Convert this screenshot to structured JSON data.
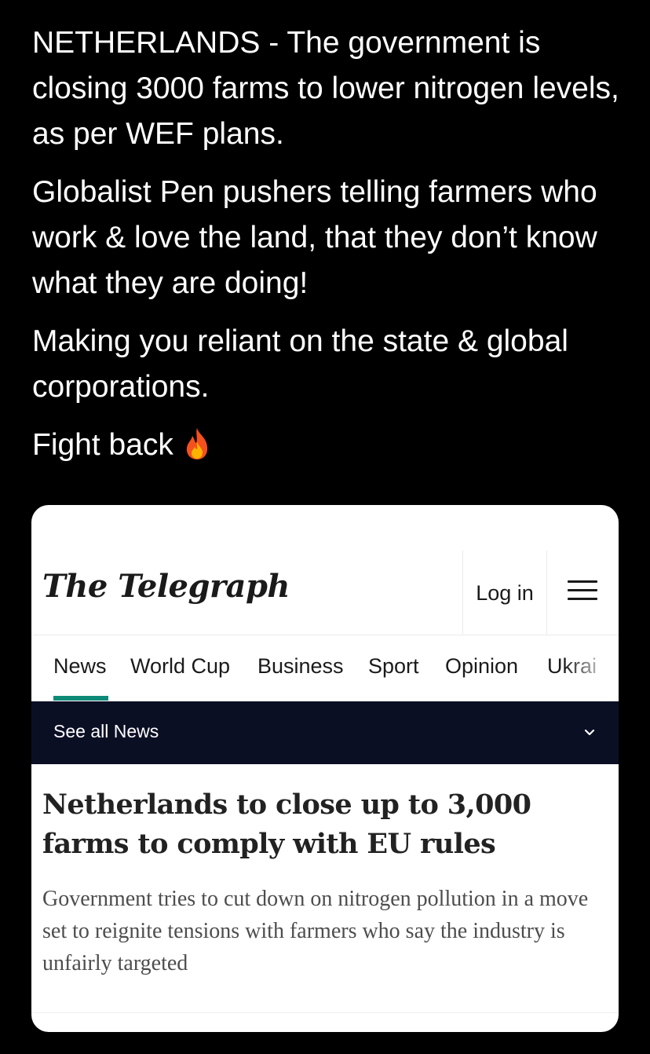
{
  "tweet": {
    "paragraphs": [
      "NETHERLANDS - The government is closing 3000 farms to lower nitrogen levels, as per WEF plans.",
      "Globalist Pen pushers telling farmers who work & love the land, that they don’t know what they are doing!",
      "Making you reliant on the state & global corporations."
    ],
    "last_line": "Fight back",
    "last_icon": "fire-emoji"
  },
  "card": {
    "logo": "The Telegraph",
    "login_label": "Log in",
    "menu_icon": "hamburger-menu-icon",
    "nav": [
      "News",
      "World Cup",
      "Business",
      "Sport",
      "Opinion",
      "Ukrai"
    ],
    "active_nav": "News",
    "subnav_label": "See all News",
    "headline": "Netherlands to close up to 3,000 farms to comply with EU rules",
    "standfirst": "Government tries to cut down on nitrogen pollution in a move set to reignite tensions with farmers who say the industry is unfairly targeted",
    "colors": {
      "accent": "#0e8a78",
      "subnav_bg": "#0b0f24",
      "page_bg": "#000000"
    }
  }
}
